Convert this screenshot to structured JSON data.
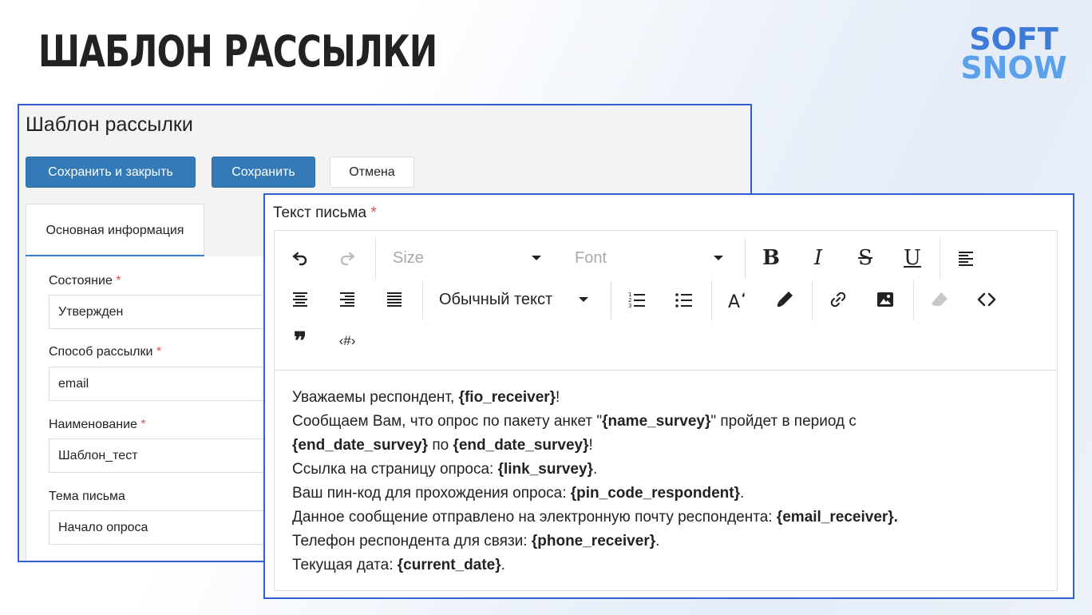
{
  "slide": {
    "title": "ШАБЛОН РАССЫЛКИ",
    "logo_line1": "SOFT",
    "logo_line2": "SNOW",
    "logo_color": "#3d7bd9"
  },
  "back_window": {
    "title": "Шаблон рассылки",
    "buttons": {
      "save_close": "Сохранить и закрыть",
      "save": "Сохранить",
      "cancel": "Отмена"
    },
    "tab_main": "Основная информация",
    "fields": [
      {
        "label": "Состояние",
        "required": "*",
        "value": "Утвержден"
      },
      {
        "label": "Способ рассылки",
        "required": "*",
        "value": "email"
      },
      {
        "label": "Наименование",
        "required": "*",
        "value": "Шаблон_тест"
      },
      {
        "label": "Тема письма",
        "required": "",
        "value": "Начало опроса"
      }
    ]
  },
  "front_window": {
    "label": "Текст письма",
    "required": "*",
    "toolbar": {
      "size_placeholder": "Size",
      "font_placeholder": "Font",
      "bold": "B",
      "italic": "I",
      "strike": "S",
      "underline": "U",
      "paragraph_style": "Обычный текст",
      "quote": "❞",
      "tag": "‹#›"
    },
    "content": {
      "l1_a": "Уважаемы респондент, ",
      "l1_b": "{fio_receiver}",
      "l1_c": "!",
      "l2_a": "Сообщаем Вам, что опрос по пакету анкет \"",
      "l2_b": "{name_survey}",
      "l2_c": "\" пройдет в период с",
      "l3_a": "{end_date_survey}",
      "l3_b": " по ",
      "l3_c": "{end_date_survey}",
      "l3_d": "!",
      "l4_a": "Ссылка на страницу опроса: ",
      "l4_b": "{link_survey}",
      "l4_c": ".",
      "l5_a": "Ваш пин-код для прохождения опроса: ",
      "l5_b": "{pin_code_respondent}",
      "l5_c": ".",
      "l6_a": "Данное сообщение отправлено на электронную почту респондента: ",
      "l6_b": "{email_receiver}.",
      "l7_a": "Телефон респондента для связи: ",
      "l7_b": "{phone_receiver}",
      "l7_c": ".",
      "l8_a": "Текущая дата: ",
      "l8_b": "{current_date}",
      "l8_c": "."
    }
  }
}
